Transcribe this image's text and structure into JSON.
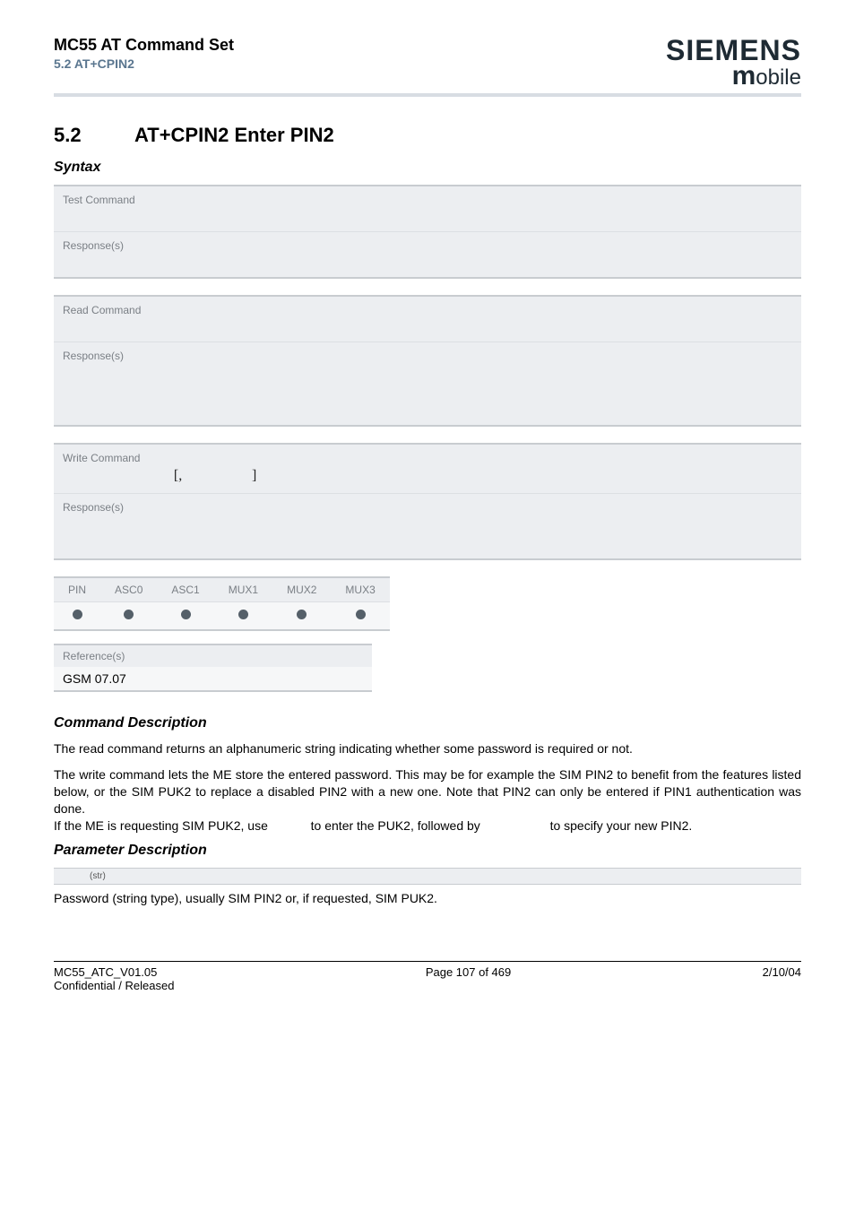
{
  "header": {
    "title": "MC55 AT Command Set",
    "subtitle": "5.2 AT+CPIN2",
    "brand": "SIEMENS",
    "brand_sub_m": "m",
    "brand_sub_rest": "obile"
  },
  "section": {
    "number": "5.2",
    "title": "AT+CPIN2   Enter PIN2"
  },
  "syntax_heading": "Syntax",
  "blocks": {
    "test": {
      "label": "Test Command",
      "resp_label": "Response(s)"
    },
    "read": {
      "label": "Read Command",
      "resp_label": "Response(s)"
    },
    "write": {
      "label": "Write Command",
      "bracket_open": "[,",
      "bracket_close": "]",
      "resp_label": "Response(s)"
    }
  },
  "matrix": {
    "headers": [
      "PIN",
      "ASC0",
      "ASC1",
      "MUX1",
      "MUX2",
      "MUX3"
    ],
    "row": [
      true,
      true,
      true,
      true,
      true,
      true
    ]
  },
  "references": {
    "label": "Reference(s)",
    "value": "GSM 07.07"
  },
  "cmd_desc_heading": "Command Description",
  "cmd_desc_p1": "The read command returns an alphanumeric string indicating whether some password is required or not.",
  "cmd_desc_p2a": "The write command lets the ME store the entered password. This may be for example the SIM PIN2 to benefit from the features listed below, or the SIM PUK2 to replace a disabled PIN2 with a new one. Note that PIN2 can only be entered if PIN1 authentication was done.",
  "cmd_desc_p2b_pre": "If the ME is requesting SIM PUK2, use ",
  "cmd_desc_p2b_mid": " to enter the PUK2, followed by ",
  "cmd_desc_p2b_post": " to specify your new PIN2.",
  "param_desc_heading": "Parameter Description",
  "param_bar": "(str)",
  "param_text": "Password (string type), usually SIM PIN2 or, if requested, SIM PUK2.",
  "footer": {
    "doc": "MC55_ATC_V01.05",
    "conf": "Confidential / Released",
    "page": "Page 107 of 469",
    "date": "2/10/04"
  }
}
